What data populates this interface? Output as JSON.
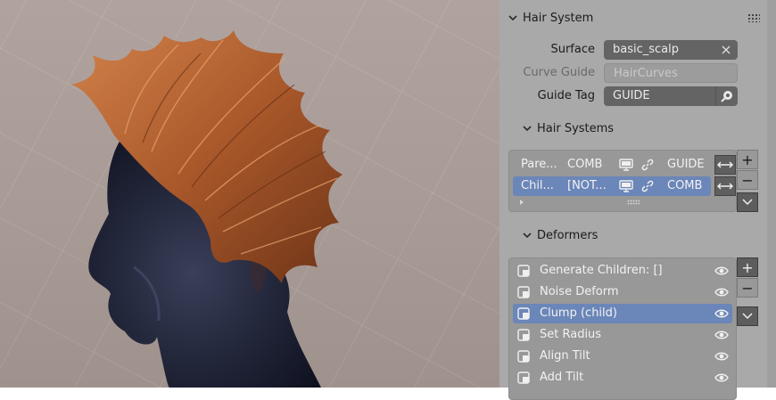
{
  "panel": {
    "header": "Hair System",
    "props": [
      {
        "label": "Surface",
        "value": "basic_scalp",
        "disabled": false
      },
      {
        "label": "Curve Guide",
        "value": "HairCurves",
        "disabled": true
      },
      {
        "label": "Guide Tag",
        "value": "GUIDE",
        "disabled": false
      }
    ],
    "hair_systems": {
      "header": "Hair Systems",
      "rows": [
        {
          "name": "Pare...",
          "mode": "COMB",
          "tag": "GUIDE",
          "selected": false
        },
        {
          "name": "Chil...",
          "mode": "[NOT...",
          "tag": "COMB",
          "selected": true
        }
      ]
    },
    "deformers": {
      "header": "Deformers",
      "items": [
        {
          "label": "Generate Children: []",
          "selected": false
        },
        {
          "label": "Noise Deform",
          "selected": false
        },
        {
          "label": "Clump (child)",
          "selected": true
        },
        {
          "label": "Set Radius",
          "selected": false
        },
        {
          "label": "Align Tilt",
          "selected": false
        },
        {
          "label": "Add Tilt",
          "selected": false
        }
      ]
    },
    "buttons": {
      "add": "+",
      "remove": "−"
    }
  },
  "colors": {
    "panel_bg": "#a9a9a9",
    "field_bg": "#646464",
    "selection": "#6b86b8",
    "hair": "#b8632f"
  },
  "icons": [
    "chevron-down-icon",
    "grip-icon",
    "close-icon",
    "eyedropper-icon",
    "monitor-icon",
    "link-icon",
    "swap-arrows-icon",
    "modifier-icon",
    "eye-icon",
    "plus-icon",
    "minus-icon"
  ]
}
